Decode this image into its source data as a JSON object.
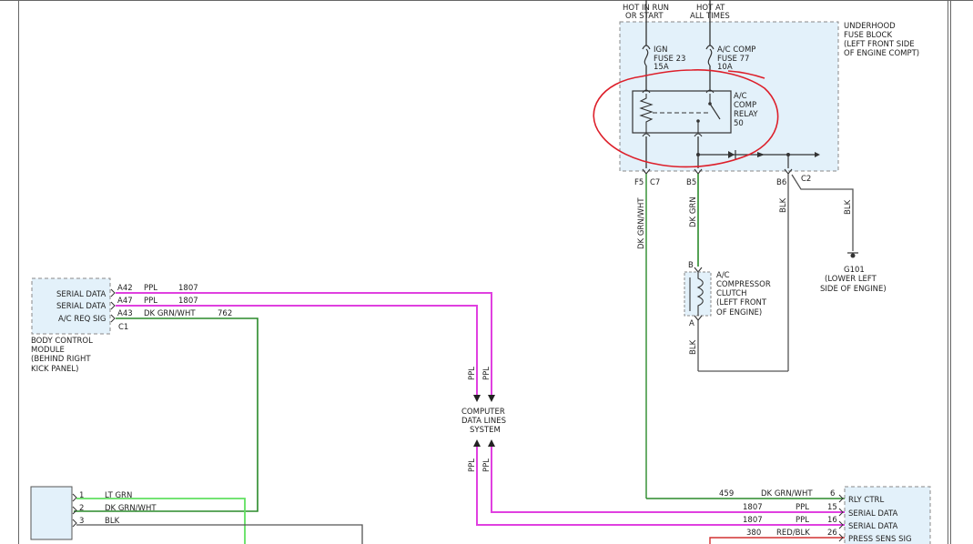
{
  "power": {
    "hot_run_1": "HOT IN RUN",
    "hot_run_2": "OR START",
    "hot_all_1": "HOT AT",
    "hot_all_2": "ALL TIMES"
  },
  "fuse_block": {
    "line1": "UNDERHOOD",
    "line2": "FUSE BLOCK",
    "line3": "(LEFT FRONT SIDE",
    "line4": "OF ENGINE COMPT)"
  },
  "fuses": {
    "ign_1": "IGN",
    "ign_2": "FUSE 23",
    "ign_3": "15A",
    "ac_1": "A/C COMP",
    "ac_2": "FUSE 77",
    "ac_3": "10A"
  },
  "relay": {
    "line1": "A/C",
    "line2": "COMP",
    "line3": "RELAY",
    "line4": "50"
  },
  "connectors": {
    "f5": "F5",
    "c7": "C7",
    "b5": "B5",
    "b6": "B6",
    "c2": "C2",
    "b": "B",
    "a": "A",
    "c1": "C1"
  },
  "wires": {
    "dk_grn_wht": "DK GRN/WHT",
    "dk_grn": "DK GRN",
    "blk": "BLK",
    "ppl": "PPL",
    "lt_grn": "LT GRN",
    "red_blk": "RED/BLK"
  },
  "ground": {
    "id": "G101",
    "line1": "(LOWER LEFT",
    "line2": "SIDE OF ENGINE)"
  },
  "clutch": {
    "line1": "A/C",
    "line2": "COMPRESSOR",
    "line3": "CLUTCH",
    "line4": "(LEFT FRONT",
    "line5": "OF ENGINE)"
  },
  "bcm": {
    "serial_data": "SERIAL DATA",
    "ac_req_sig": "A/C REQ SIG",
    "pins": [
      "A42",
      "A47",
      "A43"
    ],
    "circuits": [
      "1807",
      "1807",
      "762"
    ],
    "name1": "BODY CONTROL",
    "name2": "MODULE",
    "name3": "(BEHIND RIGHT",
    "name4": "KICK PANEL)"
  },
  "data_lines": {
    "line1": "COMPUTER",
    "line2": "DATA LINES",
    "line3": "SYSTEM"
  },
  "pcm": {
    "rly_ctrl": "RLY CTRL",
    "serial_data": "SERIAL DATA",
    "press_sens_sig": "PRESS SENS SIG",
    "pins": [
      "6",
      "15",
      "16",
      "26"
    ],
    "circuits": [
      "459",
      "1807",
      "1807",
      "380"
    ]
  },
  "bottom_conn": {
    "pins": [
      "1",
      "2",
      "3"
    ]
  }
}
